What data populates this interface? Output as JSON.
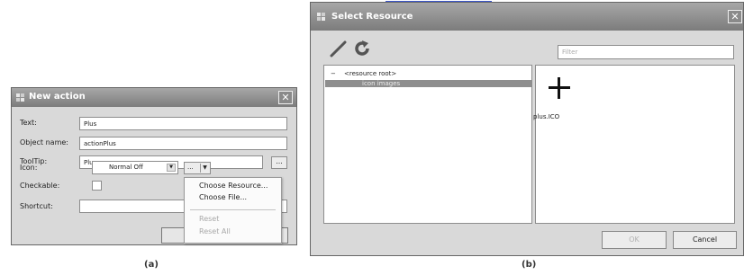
{
  "dialog_a": {
    "title": "New action",
    "labels": {
      "text": "Text:",
      "object_name": "Object name:",
      "tooltip": "ToolTip:",
      "icon": "Icon:",
      "checkable": "Checkable:",
      "shortcut": "Shortcut:"
    },
    "values": {
      "text": "Plus",
      "object_name": "actionPlus",
      "tooltip": "Plus",
      "icon_mode": "Normal Off",
      "icon_button": "...",
      "tooltip_button": "..."
    },
    "menu": {
      "items": [
        {
          "label": "Choose Resource...",
          "enabled": true
        },
        {
          "label": "Choose File...",
          "enabled": true
        },
        {
          "label": "Reset",
          "enabled": false
        },
        {
          "label": "Reset All",
          "enabled": false
        }
      ]
    },
    "caption": "(a)"
  },
  "dialog_b": {
    "title": "Select Resource",
    "filter_placeholder": "Filter",
    "tree": {
      "root": "<resource root>",
      "child": "icon images",
      "expander": "−"
    },
    "resource": {
      "icon": "plus-icon",
      "name": "plus.ICO"
    },
    "buttons": {
      "ok": "OK",
      "cancel": "Cancel"
    },
    "caption": "(b)"
  },
  "colors": {
    "titlebar": "#8f8f8f",
    "dialog_bg": "#d9d9d9",
    "selection": "#8e8e8e",
    "link": "#3b55c9"
  }
}
